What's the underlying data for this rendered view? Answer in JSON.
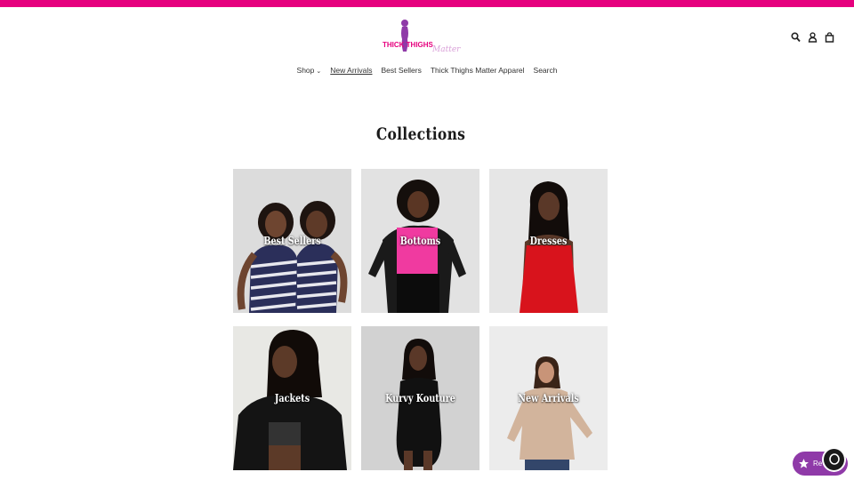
{
  "brand": {
    "logo_text_main": "THICK THIGHS",
    "logo_text_script": "Matter",
    "accent_color": "#e6007e",
    "purple": "#8f3aa8"
  },
  "header_icons": [
    "search-icon",
    "account-icon",
    "cart-icon"
  ],
  "nav": {
    "items": [
      {
        "label": "Shop",
        "has_dropdown": true
      },
      {
        "label": "New Arrivals",
        "active": true
      },
      {
        "label": "Best Sellers"
      },
      {
        "label": "Thick Thighs Matter Apparel"
      },
      {
        "label": "Search"
      }
    ]
  },
  "page": {
    "title": "Collections"
  },
  "collections": [
    {
      "label": "Best Sellers"
    },
    {
      "label": "Bottoms"
    },
    {
      "label": "Dresses"
    },
    {
      "label": "Jackets"
    },
    {
      "label": "Kurvy Kouture"
    },
    {
      "label": "New Arrivals"
    }
  ],
  "widgets": {
    "reviews_label": "Reviews"
  }
}
